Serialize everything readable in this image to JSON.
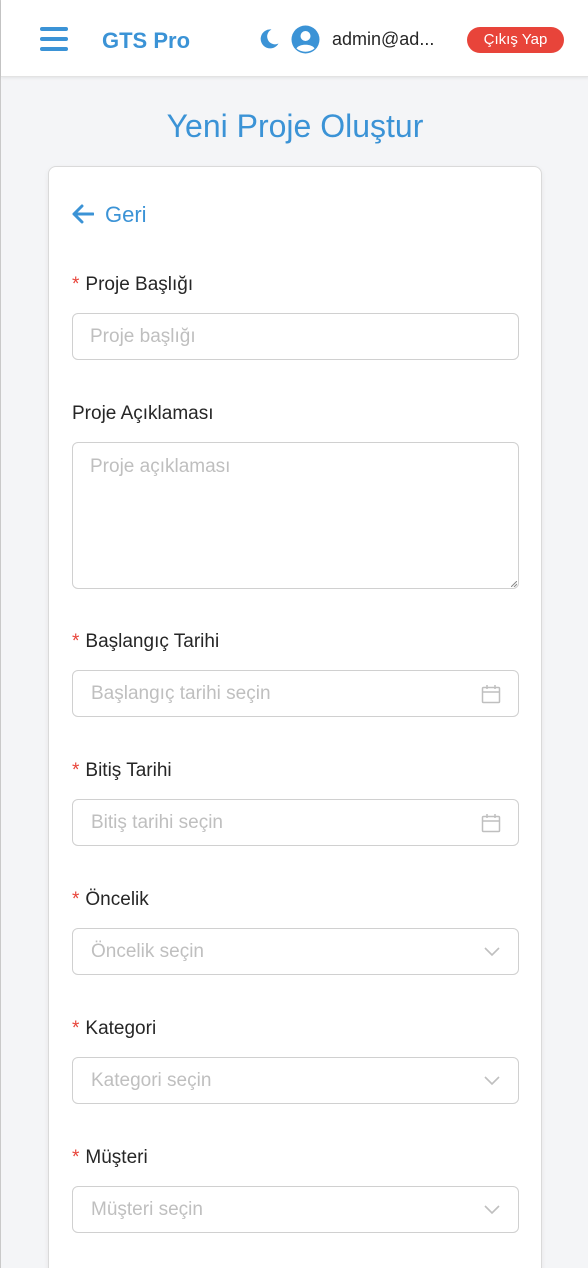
{
  "header": {
    "brand": "GTS Pro",
    "user_email": "admin@ad...",
    "logout_label": "Çıkış Yap",
    "icons": {
      "menu": "hamburger-menu-icon",
      "theme": "moon-icon",
      "user": "user-avatar-icon"
    }
  },
  "page": {
    "title": "Yeni Proje Oluştur"
  },
  "form": {
    "back_label": "Geri",
    "project_title": {
      "label": "Proje Başlığı",
      "required": true,
      "placeholder": "Proje başlığı",
      "value": ""
    },
    "project_description": {
      "label": "Proje Açıklaması",
      "required": false,
      "placeholder": "Proje açıklaması",
      "value": ""
    },
    "start_date": {
      "label": "Başlangıç Tarihi",
      "required": true,
      "placeholder": "Başlangıç tarihi seçin",
      "icon": "calendar-icon"
    },
    "end_date": {
      "label": "Bitiş Tarihi",
      "required": true,
      "placeholder": "Bitiş tarihi seçin",
      "icon": "calendar-icon"
    },
    "priority": {
      "label": "Öncelik",
      "required": true,
      "placeholder": "Öncelik seçin",
      "icon": "chevron-down-icon"
    },
    "category": {
      "label": "Kategori",
      "required": true,
      "placeholder": "Kategori seçin",
      "icon": "chevron-down-icon"
    },
    "customer": {
      "label": "Müşteri",
      "required": true,
      "placeholder": "Müşteri seçin",
      "icon": "chevron-down-icon"
    }
  },
  "colors": {
    "accent": "#3b93d6",
    "danger": "#e8443a",
    "background": "#f4f5f7"
  }
}
